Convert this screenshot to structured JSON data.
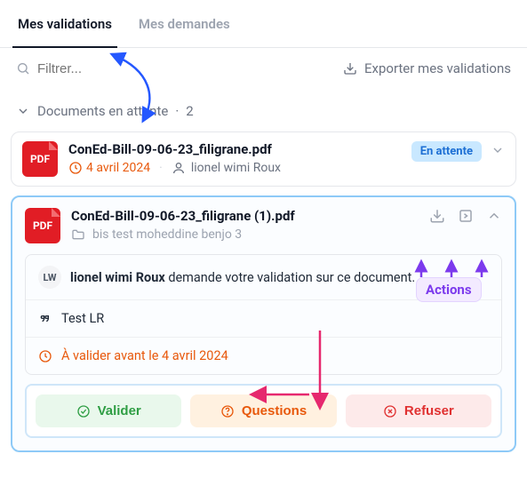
{
  "tabs": {
    "validations": "Mes validations",
    "requests": "Mes demandes"
  },
  "filter": {
    "placeholder": "Filtrer..."
  },
  "export_label": "Exporter mes validations",
  "section": {
    "title": "Documents en attente",
    "count": "2"
  },
  "card1": {
    "title": "ConEd-Bill-09-06-23_filigrane.pdf",
    "date": "4 avril 2024",
    "user": "lionel wimi Roux",
    "status": "En attente",
    "pdf": "PDF"
  },
  "card2": {
    "title": "ConEd-Bill-09-06-23_filigrane (1).pdf",
    "folder": "bis test moheddine benjo 3",
    "pdf": "PDF",
    "req_avatar": "LW",
    "req_name": "lionel wimi Roux",
    "req_text": " demande votre validation sur ce document.",
    "note": "Test LR",
    "deadline": "À valider avant le 4 avril 2024",
    "btn_validate": "Valider",
    "btn_questions": "Questions",
    "btn_refuse": "Refuser"
  },
  "annotation": {
    "actions": "Actions"
  }
}
